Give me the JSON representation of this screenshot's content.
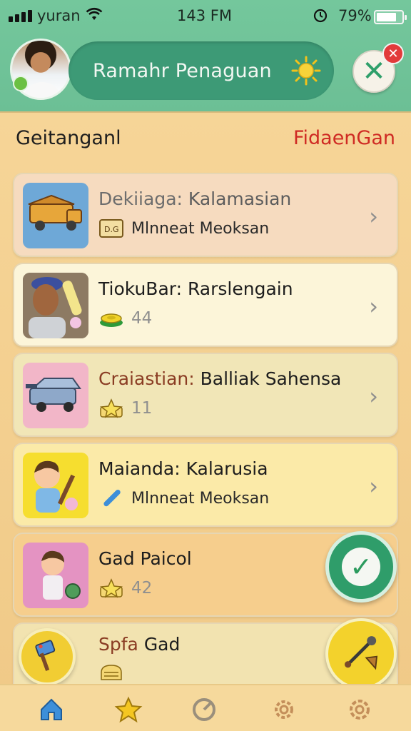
{
  "status_bar": {
    "carrier": "yuran",
    "time": "143 FM",
    "battery_text": "79%",
    "battery_level": 0.79,
    "icons": [
      "signal-icon",
      "wifi-icon",
      "alarm-icon",
      "battery-icon"
    ]
  },
  "header": {
    "title": "Ramahr Penaguan",
    "icons": [
      "avatar",
      "sun-icon",
      "close-icon"
    ]
  },
  "section": {
    "left_label": "Geitanganl",
    "right_link": "FidaenGan"
  },
  "list": [
    {
      "title_prefix": "Dekiiaga:",
      "title_main": "Kalamasian",
      "sub_text": "Mlnneat  Meoksan",
      "sub_icon": "tag-icon",
      "thumb": "truck-icon",
      "bg": "#f6dbbf"
    },
    {
      "title_prefix": "TiokuBar:",
      "title_main": "Rarslengain",
      "sub_text": "44",
      "sub_icon": "coin-stack-icon",
      "thumb": "person-photo",
      "bg": "#fcf5d9"
    },
    {
      "title_prefix": "Craiastian:",
      "title_main": "Balliak Sahensa",
      "sub_text": "11",
      "sub_icon": "star-badge-icon",
      "thumb": "vehicle-icon",
      "bg": "#f1e6b7"
    },
    {
      "title_prefix": "Maianda:",
      "title_main": "Kalarusia",
      "sub_text": "Mlnneat  Meoksan",
      "sub_icon": "wrench-icon",
      "thumb": "cartoon-boy-icon",
      "bg": "#fbeaa8"
    },
    {
      "title_prefix": "",
      "title_main": "Gad Paicol",
      "sub_text": "42",
      "sub_icon": "star-badge-icon",
      "thumb": "cartoon-kid-icon",
      "bg": "#f6ce8d"
    },
    {
      "title_prefix": "Spfa",
      "title_main": "Gad",
      "sub_text": "",
      "sub_icon": "bread-icon",
      "thumb": "",
      "bg": "#f2e3b0"
    }
  ],
  "fabs": {
    "check": "check-icon",
    "tool": "tools-icon",
    "left": "brush-icon"
  },
  "bottom_nav": [
    "home-icon",
    "star-icon",
    "refresh-icon",
    "settings-icon",
    "gear-icon"
  ],
  "colors": {
    "header_green": "#6cbf95",
    "pill_green": "#3d9a76",
    "accent_red": "#cf2a23",
    "background": "#f3cf8f"
  }
}
